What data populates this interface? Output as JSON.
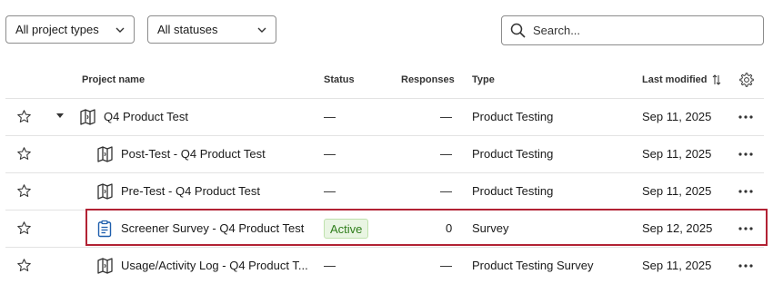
{
  "filters": {
    "project_types": "All project types",
    "statuses": "All statuses",
    "search_placeholder": "Search..."
  },
  "columns": {
    "name": "Project name",
    "status": "Status",
    "responses": "Responses",
    "type": "Type",
    "last_modified": "Last modified"
  },
  "rows": [
    {
      "name": "Q4 Product Test",
      "status": "—",
      "responses": "—",
      "type": "Product Testing",
      "modified": "Sep 11, 2025",
      "icon": "product-test-icon"
    },
    {
      "name": "Post-Test - Q4 Product Test",
      "status": "—",
      "responses": "—",
      "type": "Product Testing",
      "modified": "Sep 11, 2025",
      "icon": "product-test-icon"
    },
    {
      "name": "Pre-Test - Q4 Product Test",
      "status": "—",
      "responses": "—",
      "type": "Product Testing",
      "modified": "Sep 11, 2025",
      "icon": "product-test-icon"
    },
    {
      "name": "Screener Survey - Q4 Product Test",
      "status": "Active",
      "responses": "0",
      "type": "Survey",
      "modified": "Sep 12, 2025",
      "icon": "survey-clipboard-icon"
    },
    {
      "name": "Usage/Activity Log - Q4 Product T...",
      "status": "—",
      "responses": "—",
      "type": "Product Testing Survey",
      "modified": "Sep 11, 2025",
      "icon": "product-test-icon"
    }
  ],
  "colors": {
    "highlight": "#b22234",
    "active_badge_bg": "#e9f5e3",
    "active_badge_text": "#2e7d1a",
    "survey_icon": "#1f5fad"
  }
}
